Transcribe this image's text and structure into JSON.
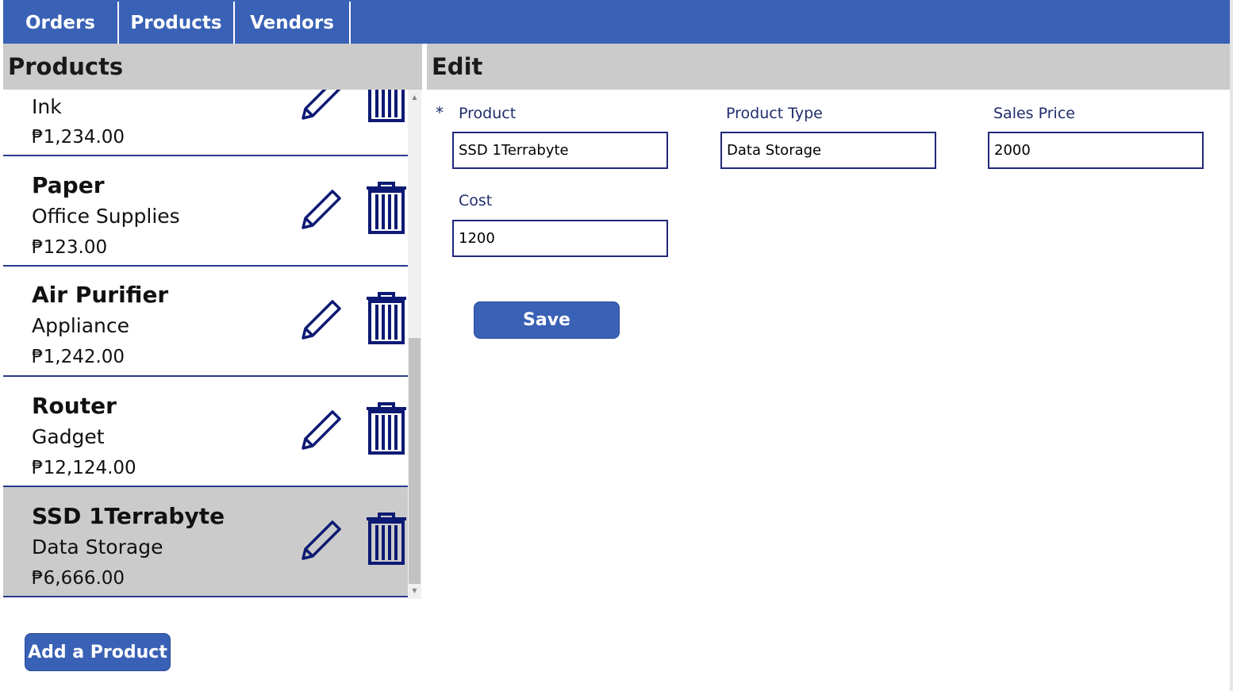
{
  "nav": {
    "tabs": [
      {
        "label": "Orders"
      },
      {
        "label": "Products"
      },
      {
        "label": "Vendors"
      }
    ]
  },
  "products_panel": {
    "title": "Products",
    "items": [
      {
        "name": "",
        "type": "Ink",
        "price": "₱1,234.00",
        "selected": false
      },
      {
        "name": "Paper",
        "type": "Office Supplies",
        "price": "₱123.00",
        "selected": false
      },
      {
        "name": "Air Purifier",
        "type": "Appliance",
        "price": "₱1,242.00",
        "selected": false
      },
      {
        "name": "Router",
        "type": "Gadget",
        "price": "₱12,124.00",
        "selected": false
      },
      {
        "name": "SSD 1Terrabyte",
        "type": "Data Storage",
        "price": "₱6,666.00",
        "selected": true
      }
    ],
    "add_button_label": "Add a Product"
  },
  "edit_panel": {
    "title": "Edit",
    "required_mark": "*",
    "fields": {
      "product": {
        "label": "Product",
        "value": "SSD 1Terrabyte"
      },
      "product_type": {
        "label": "Product Type",
        "value": "Data Storage"
      },
      "sales_price": {
        "label": "Sales Price",
        "value": "2000"
      },
      "cost": {
        "label": "Cost",
        "value": "1200"
      }
    },
    "save_label": "Save"
  },
  "colors": {
    "accent": "#3961b5",
    "header_gray": "#cbcbcb",
    "icon_navy": "#0d1a73",
    "field_border": "#1f2878"
  },
  "icons": {
    "edit": "pencil-icon",
    "delete": "trash-icon"
  }
}
